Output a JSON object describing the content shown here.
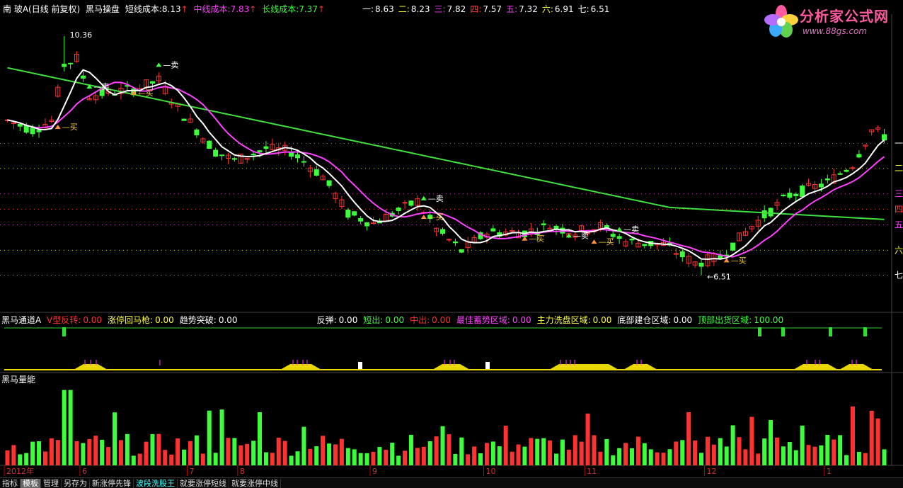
{
  "header": {
    "stock": "南 玻A(日线 前复权)",
    "indicator": "黑马操盘",
    "short_cost_label": "短线成本:",
    "short_cost": "8.13",
    "mid_cost_label": "中线成本:",
    "mid_cost": "7.83",
    "long_cost_label": "长线成本:",
    "long_cost": "7.37",
    "arrow": "↑",
    "levels": [
      {
        "k": "一:",
        "v": "8.63",
        "color": "#ffffff"
      },
      {
        "k": "二:",
        "v": "8.23",
        "color": "#ffff40"
      },
      {
        "k": "三:",
        "v": "7.82",
        "color": "#ff40ff"
      },
      {
        "k": "四:",
        "v": "7.57",
        "color": "#ff4040"
      },
      {
        "k": "五:",
        "v": "7.32",
        "color": "#ff40ff"
      },
      {
        "k": "六:",
        "v": "6.91",
        "color": "#ffff40"
      },
      {
        "k": "七:",
        "v": "6.51",
        "color": "#ffffff"
      }
    ]
  },
  "logo": {
    "title": "分析家公式网",
    "url": "www.88gs.com"
  },
  "panel2": {
    "title": "黑马通道A",
    "items": [
      {
        "k": "V型反转:",
        "v": "0.00",
        "color": "#ff3030"
      },
      {
        "k": "涨停回马枪:",
        "v": "0.00",
        "color": "#ffff40"
      },
      {
        "k": "趋势突破:",
        "v": "0.00",
        "color": "#ffffff"
      },
      {
        "k": "反弹:",
        "v": "0.00",
        "color": "#ffffff"
      },
      {
        "k": "短出:",
        "v": "0.00",
        "color": "#40ff40"
      },
      {
        "k": "中出:",
        "v": "0.00",
        "color": "#ff3030"
      },
      {
        "k": "最佳蓄势区域:",
        "v": "0.00",
        "color": "#ff40ff"
      },
      {
        "k": "主力洗盘区域:",
        "v": "0.00",
        "color": "#ffff40"
      },
      {
        "k": "底部建仓区域:",
        "v": "0.00",
        "color": "#ffffff"
      },
      {
        "k": "顶部出货区域:",
        "v": "100.00",
        "color": "#40ff40"
      }
    ]
  },
  "panel3": {
    "title": "黑马量能"
  },
  "tabs": [
    "指标",
    "模板",
    "管理",
    "另存为",
    "新涨停先锋",
    "波段洗股王",
    "就要涨停短线",
    "就要涨停中线"
  ],
  "colors": {
    "up": "#ff3232",
    "down": "#3cff3c",
    "short_line": "#ffffff",
    "mid_line": "#ff40ff",
    "long_line": "#40e040",
    "grid": "#ffff00"
  },
  "chart_data": {
    "type": "candlestick",
    "ylim": [
      6.15,
      10.6
    ],
    "x_ticks": [
      {
        "label": "2012年",
        "index": 0
      },
      {
        "label": "6",
        "index": 12
      },
      {
        "label": "7",
        "index": 29
      },
      {
        "label": "8",
        "index": 37
      },
      {
        "label": "9",
        "index": 58
      },
      {
        "label": "10",
        "index": 76
      },
      {
        "label": "11",
        "index": 92
      },
      {
        "label": "12",
        "index": 111
      },
      {
        "label": "1",
        "index": 130
      }
    ],
    "level_labels": [
      {
        "label": "一",
        "value": 8.63,
        "color": "#ffffff"
      },
      {
        "label": "二",
        "value": 8.23,
        "color": "#ffff40"
      },
      {
        "label": "三",
        "value": 7.82,
        "color": "#ff40ff"
      },
      {
        "label": "四",
        "value": 7.57,
        "color": "#ff4040"
      },
      {
        "label": "五",
        "value": 7.32,
        "color": "#ff40ff"
      },
      {
        "label": "六",
        "value": 6.91,
        "color": "#ffff40"
      },
      {
        "label": "七",
        "value": 6.51,
        "color": "#ffffff"
      }
    ],
    "annotations": [
      {
        "text": "10.36",
        "index": 9,
        "value": 10.36
      },
      {
        "text": "6.51",
        "index": 110,
        "value": 6.51
      }
    ],
    "signals": [
      {
        "text": "买",
        "type": "buy",
        "index": 8,
        "value": 8.9
      },
      {
        "text": "卖",
        "type": "sell",
        "index": 13,
        "value": 9.55
      },
      {
        "text": "买",
        "type": "buy",
        "index": 20,
        "value": 9.45
      },
      {
        "text": "卖",
        "type": "sell",
        "index": 24,
        "value": 9.9
      },
      {
        "text": "卖",
        "type": "sell",
        "index": 66,
        "value": 7.75
      },
      {
        "text": "买",
        "type": "buy",
        "index": 66,
        "value": 7.45
      },
      {
        "text": "买",
        "type": "buy",
        "index": 82,
        "value": 7.1
      },
      {
        "text": "卖",
        "type": "sell",
        "index": 89,
        "value": 7.15
      },
      {
        "text": "买",
        "type": "buy",
        "index": 93,
        "value": 7.05
      },
      {
        "text": "卖",
        "type": "sell",
        "index": 97,
        "value": 7.25
      },
      {
        "text": "买",
        "type": "buy",
        "index": 114,
        "value": 6.75
      }
    ]
  }
}
